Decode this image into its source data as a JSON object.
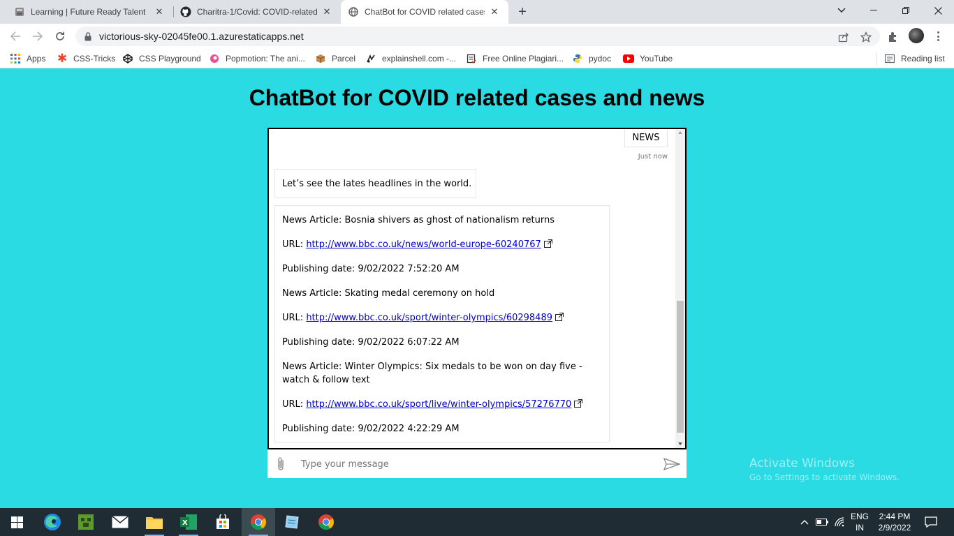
{
  "browser": {
    "tabs": [
      {
        "title": "Learning | Future Ready Talent",
        "favicon": "future-ready-icon"
      },
      {
        "title": "Charitra-1/Covid: COVID-related",
        "favicon": "github-icon"
      },
      {
        "title": "ChatBot for COVID related cases",
        "favicon": "globe-icon",
        "active": true
      }
    ],
    "address": "victorious-sky-02045fe00.1.azurestaticapps.net",
    "bookmarks": [
      {
        "label": "Apps",
        "icon": "apps-grid-icon"
      },
      {
        "label": "CSS-Tricks",
        "icon": "css-tricks-icon"
      },
      {
        "label": "CSS Playground",
        "icon": "codepen-icon"
      },
      {
        "label": "Popmotion: The ani...",
        "icon": "popmotion-icon"
      },
      {
        "label": "Parcel",
        "icon": "parcel-icon"
      },
      {
        "label": "explainshell.com -...",
        "icon": "explainshell-icon"
      },
      {
        "label": "Free Online Plagiari...",
        "icon": "plagiarism-icon"
      },
      {
        "label": "pydoc",
        "icon": "python-icon"
      },
      {
        "label": "YouTube",
        "icon": "youtube-icon"
      }
    ],
    "reading_list": "Reading list"
  },
  "page": {
    "title": "ChatBot for COVID related cases and news"
  },
  "chat": {
    "user_message": "NEWS",
    "timestamp": "Just now",
    "bot_intro": "Let’s see the lates headlines in the world.",
    "articles": [
      {
        "article_line": "News Article: Bosnia shivers as ghost of nationalism returns",
        "url_label": "URL:",
        "url": "http://www.bbc.co.uk/news/world-europe-60240767",
        "date_line": "Publishing date: 9/02/2022 7:52:20 AM"
      },
      {
        "article_line": "News Article: Skating medal ceremony on hold",
        "url_label": "URL:",
        "url": "http://www.bbc.co.uk/sport/winter-olympics/60298489",
        "date_line": "Publishing date: 9/02/2022 6:07:22 AM"
      },
      {
        "article_line": "News Article: Winter Olympics: Six medals to be won on day five - watch & follow text",
        "url_label": "URL:",
        "url": "http://www.bbc.co.uk/sport/live/winter-olympics/57276770",
        "date_line": "Publishing date: 9/02/2022 4:22:29 AM"
      }
    ],
    "input_placeholder": "Type your message"
  },
  "watermark": {
    "line1": "Activate Windows",
    "line2": "Go to Settings to activate Windows."
  },
  "taskbar": {
    "apps": [
      "windows-start-icon",
      "edge-icon",
      "minecraft-icon",
      "mail-icon",
      "file-explorer-icon",
      "excel-icon",
      "microsoft-store-icon",
      "chrome-icon",
      "notepad-icon",
      "chrome-icon"
    ],
    "language": "ENG",
    "region": "IN",
    "time": "2:44 PM",
    "date": "2/9/2022"
  },
  "colors": {
    "page_background": "#2adbe3",
    "link": "#0000cc",
    "taskbar": "#1f2c34"
  }
}
